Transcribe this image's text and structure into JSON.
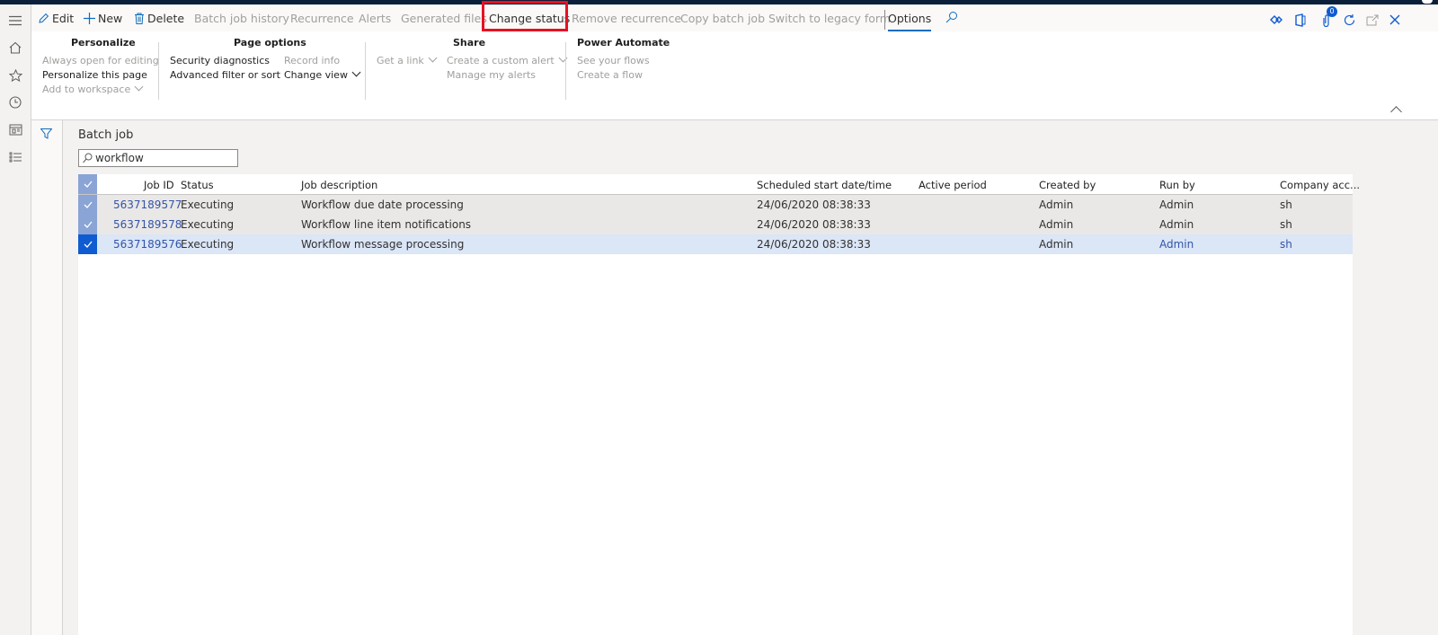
{
  "toolbar": {
    "edit": "Edit",
    "new": "New",
    "delete": "Delete",
    "batch_job_history": "Batch job history",
    "recurrence": "Recurrence",
    "alerts": "Alerts",
    "generated_files": "Generated files",
    "change_status": "Change status",
    "remove_recurrence": "Remove recurrence",
    "copy_batch_job": "Copy batch job",
    "switch_legacy": "Switch to legacy form",
    "options": "Options",
    "notification_count": "0"
  },
  "ribbon": {
    "personalize": {
      "title": "Personalize",
      "always_open": "Always open for editing",
      "personalize_page": "Personalize this page",
      "add_workspace": "Add to workspace"
    },
    "page_options": {
      "title": "Page options",
      "security": "Security diagnostics",
      "advanced_filter": "Advanced filter or sort",
      "record_info": "Record info",
      "change_view": "Change view"
    },
    "share": {
      "title": "Share",
      "get_link": "Get a link",
      "custom_alert": "Create a custom alert",
      "manage_alerts": "Manage my alerts"
    },
    "power_automate": {
      "title": "Power Automate",
      "see_flows": "See your flows",
      "create_flow": "Create a flow"
    }
  },
  "page": {
    "title": "Batch job",
    "search_value": "workflow"
  },
  "grid": {
    "headers": {
      "job_id": "Job ID",
      "status": "Status",
      "description": "Job description",
      "scheduled": "Scheduled start date/time",
      "active_period": "Active period",
      "created_by": "Created by",
      "run_by": "Run by",
      "company": "Company acc..."
    },
    "rows": [
      {
        "job_id": "5637189577",
        "status": "Executing",
        "description": "Workflow due date processing",
        "scheduled": "24/06/2020 08:38:33",
        "active_period": "",
        "created_by": "Admin",
        "run_by": "Admin",
        "company": "sh"
      },
      {
        "job_id": "5637189578",
        "status": "Executing",
        "description": "Workflow line item notifications",
        "scheduled": "24/06/2020 08:38:33",
        "active_period": "",
        "created_by": "Admin",
        "run_by": "Admin",
        "company": "sh"
      },
      {
        "job_id": "5637189576",
        "status": "Executing",
        "description": "Workflow message processing",
        "scheduled": "24/06/2020 08:38:33",
        "active_period": "",
        "created_by": "Admin",
        "run_by": "Admin",
        "company": "sh"
      }
    ]
  },
  "colors": {
    "accent": "#0f6cbd",
    "highlight": "#e81123",
    "link": "#3454a8"
  },
  "icons": {
    "nav": [
      "hamburger-icon",
      "home-icon",
      "star-icon",
      "clock-icon",
      "workspace-icon",
      "list-icon"
    ],
    "toolbar_right": [
      "diamond-icon",
      "office-icon",
      "attachment-icon",
      "refresh-icon",
      "popout-icon",
      "close-icon"
    ]
  }
}
